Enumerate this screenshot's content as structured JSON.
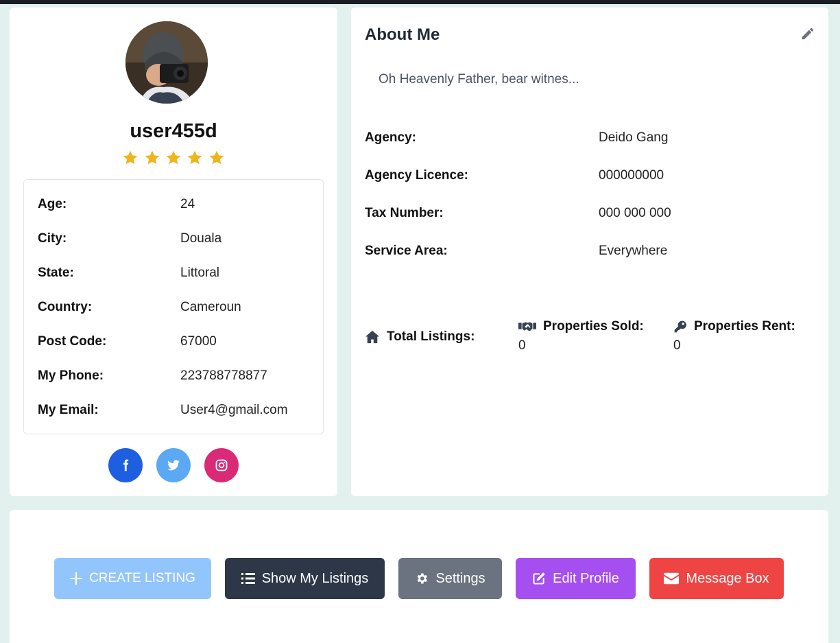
{
  "profile": {
    "username": "user455d",
    "rating": 5,
    "details": [
      {
        "label": "Age:",
        "value": "24"
      },
      {
        "label": "City:",
        "value": "Douala"
      },
      {
        "label": "State:",
        "value": "Littoral"
      },
      {
        "label": "Country:",
        "value": "Cameroun"
      },
      {
        "label": "Post Code:",
        "value": "67000"
      },
      {
        "label": "My Phone:",
        "value": "223788778877"
      },
      {
        "label": "My Email:",
        "value": "User4@gmail.com"
      }
    ],
    "socials": [
      {
        "name": "facebook",
        "icon": "facebook-icon",
        "color": "#1d5fe0"
      },
      {
        "name": "twitter",
        "icon": "twitter-icon",
        "color": "#5ba8f5"
      },
      {
        "name": "instagram",
        "icon": "instagram-icon",
        "color": "#da2a77"
      }
    ]
  },
  "about": {
    "title": "About Me",
    "bio": "Oh Heavenly Father, bear witnes...",
    "info": [
      {
        "label": "Agency:",
        "value": "Deido Gang"
      },
      {
        "label": "Agency Licence:",
        "value": "000000000"
      },
      {
        "label": "Tax Number:",
        "value": "000 000 000"
      },
      {
        "label": "Service Area:",
        "value": "Everywhere"
      }
    ],
    "stats": {
      "total_label": "Total Listings:",
      "sold_label": "Properties Sold:",
      "sold_value": "0",
      "rent_label": "Properties Rent:",
      "rent_value": "0"
    }
  },
  "actions": {
    "create": "CREATE LISTING",
    "show": "Show My Listings",
    "settings": "Settings",
    "edit": "Edit Profile",
    "message": "Message Box"
  },
  "colors": {
    "background": "#e3f1ee",
    "star": "#f0b41c",
    "create": "#93c5fd",
    "show": "#2d3748",
    "settings": "#6b7280",
    "edit": "#a64ff0",
    "message": "#ef4444"
  }
}
